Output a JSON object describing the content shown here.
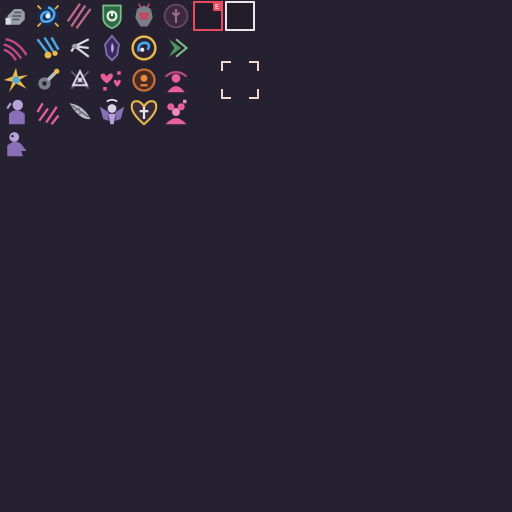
{
  "sprite_sheet": {
    "columns": 8,
    "rows": [
      [
        "gauntlet-icon",
        "vortex-icon",
        "claw-slash-icon",
        "shield-icon",
        "armored-dragon-icon",
        "rune-icon",
        "selected-slot",
        "empty-slot"
      ],
      [
        "wave-slash-icon",
        "triple-strike-icon",
        "spider-claw-icon",
        "void-crystal-icon",
        "swirl-orb-icon",
        "dash-chevron-icon"
      ],
      [
        "burst-icon",
        "wrench-icon",
        "spirit-sigil-icon",
        "hearts-icon",
        "orange-orb-icon",
        "pink-summon-icon"
      ],
      [
        "purple-figure-icon",
        "rain-strike-icon",
        "feather-blast-icon",
        "winged-demon-icon",
        "holy-heart-icon",
        "pink-squad-icon"
      ],
      [
        "ghost-figure-icon"
      ]
    ]
  },
  "selected_slot": {
    "tag": "E",
    "color": "#e84a5f"
  },
  "empty_slot": {
    "color": "#e8e4ec"
  },
  "reticle": {
    "color": "#f2d8d0"
  },
  "colors": {
    "background": "#262130",
    "pink": "#e85f9a",
    "purple": "#8a6fb8",
    "gold": "#e8b84a",
    "green": "#4a9a5f",
    "blue": "#4aa8e8",
    "grey": "#9aa0a8"
  }
}
